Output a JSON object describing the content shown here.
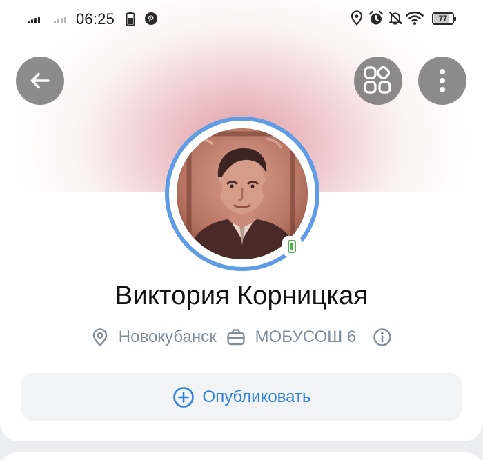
{
  "status_bar": {
    "time": "06:25",
    "battery": "77"
  },
  "header": {
    "back_icon": "arrow-left-icon",
    "services_icon": "services-grid-icon",
    "more_icon": "more-vertical-icon"
  },
  "profile": {
    "name": "Виктория Корницкая",
    "city": "Новокубанск",
    "work": "МОБУСОШ 6",
    "online_icon": "mobile-online-icon"
  },
  "actions": {
    "publish_label": "Опубликовать"
  },
  "colors": {
    "accent": "#2d81e0",
    "avatar_ring": "#5e9de6",
    "online": "#4bb34b",
    "meta_text": "#818c99",
    "button_bg": "#f2f3f5"
  }
}
